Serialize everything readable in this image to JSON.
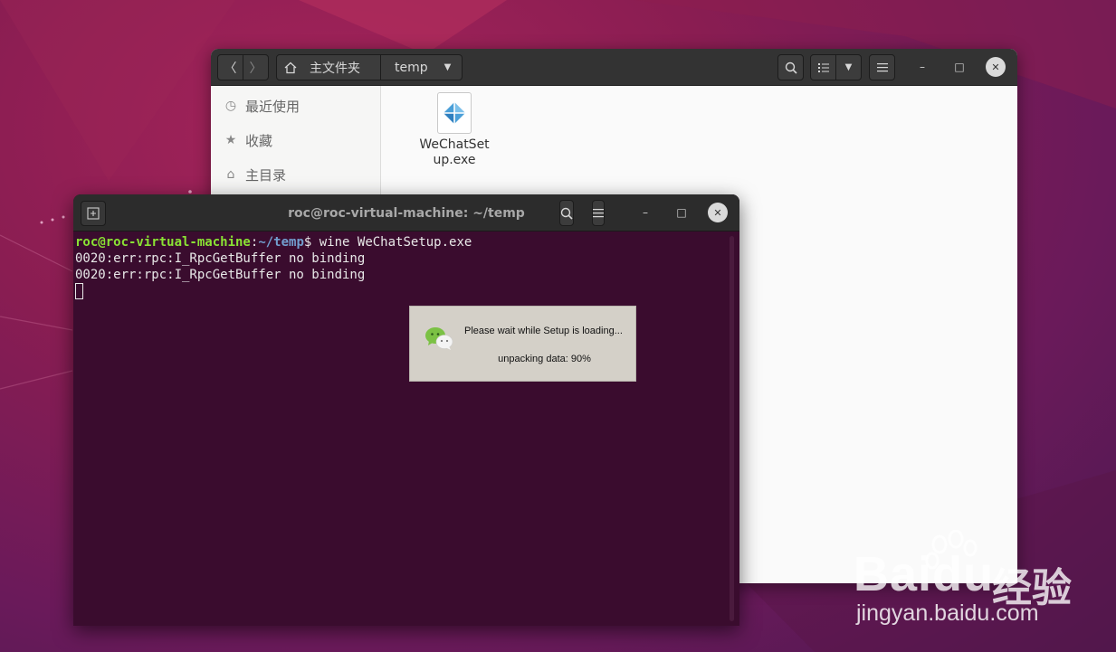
{
  "desktop": {
    "watermark": {
      "brand": "Baidu",
      "brand_cn": "经验",
      "url": "jingyan.baidu.com"
    }
  },
  "file_manager": {
    "nav": {
      "back_icon": "〈",
      "forward_icon": "〉"
    },
    "breadcrumb": {
      "home_label": "主文件夹",
      "current_label": "temp"
    },
    "window_controls": {
      "minimize": "–",
      "maximize": "□",
      "close": "✕"
    },
    "sidebar": {
      "items": [
        {
          "label": "最近使用",
          "icon": "clock-icon",
          "glyph": "◷"
        },
        {
          "label": "收藏",
          "icon": "star-icon",
          "glyph": "★"
        },
        {
          "label": "主目录",
          "icon": "home-icon",
          "glyph": "⌂"
        }
      ]
    },
    "files": [
      {
        "name": "WeChatSetup.exe",
        "name_line1": "WeChatSet",
        "name_line2": "up.exe"
      }
    ]
  },
  "terminal": {
    "title": "roc@roc-virtual-machine: ~/temp",
    "prompt_user": "roc@roc-virtual-machine",
    "prompt_sep": ":",
    "prompt_path": "~/temp",
    "prompt_end": "$ ",
    "command": "wine WeChatSetup.exe",
    "output": [
      "0020:err:rpc:I_RpcGetBuffer no binding",
      "0020:err:rpc:I_RpcGetBuffer no binding"
    ]
  },
  "setup_dialog": {
    "message": "Please wait while Setup is loading...",
    "status": "unpacking data: 90%",
    "progress_percent": 90
  }
}
